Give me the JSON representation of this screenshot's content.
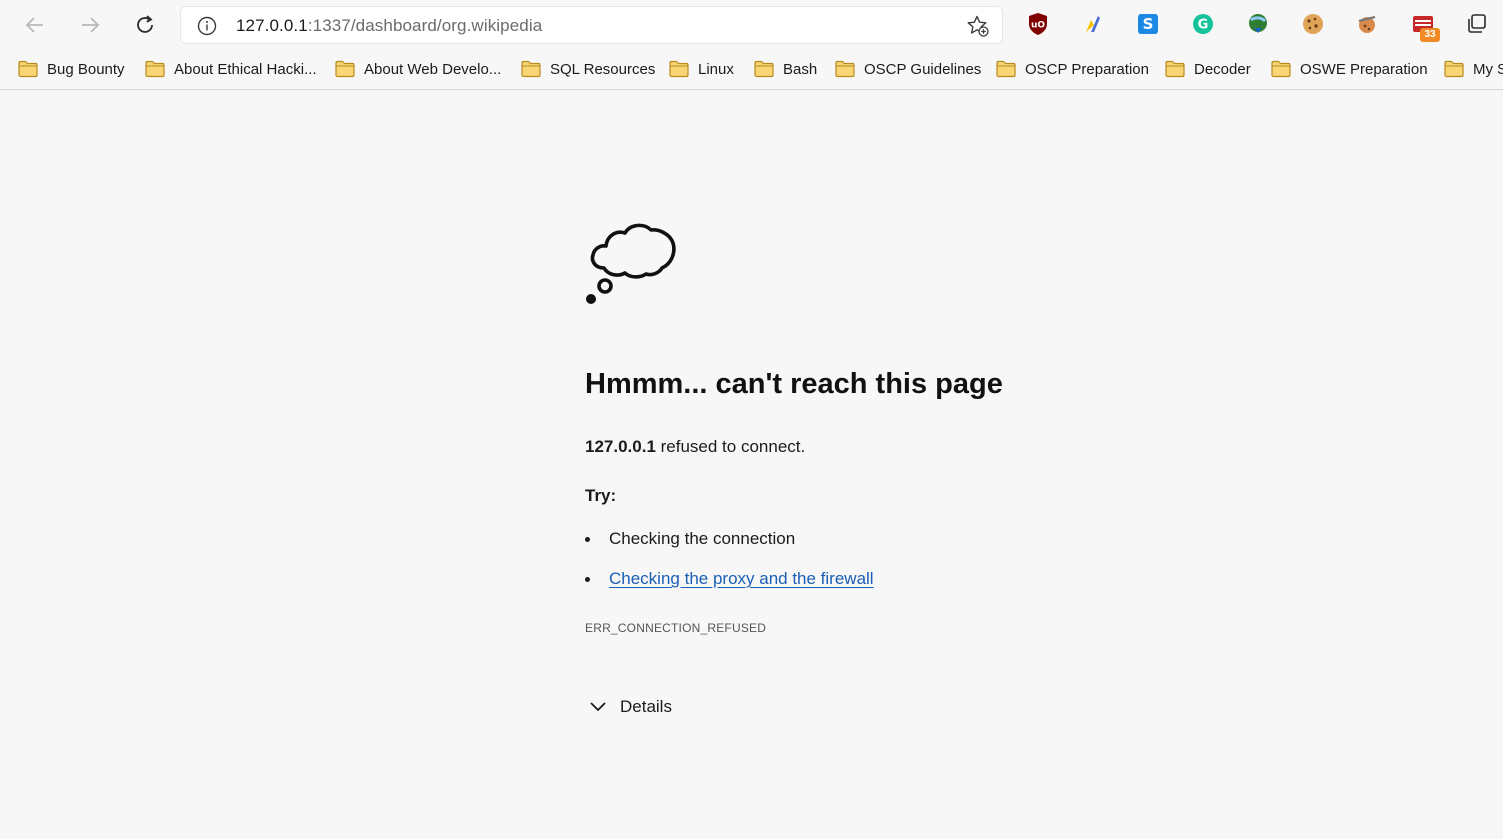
{
  "browser": {
    "address_bar": {
      "url_host": "127.0.0.1",
      "url_rest": ":1337/dashboard/org.wikipedia"
    },
    "extensions": [
      {
        "name": "ublock-origin-icon"
      },
      {
        "name": "wappalyzer-icon"
      },
      {
        "name": "s-extension-icon"
      },
      {
        "name": "grammarly-icon"
      },
      {
        "name": "idm-integration-icon"
      },
      {
        "name": "cookie-editor-icon"
      },
      {
        "name": "cookie-extension-icon"
      },
      {
        "name": "tabs-extension-icon",
        "badge": "33"
      }
    ],
    "bookmarks": [
      {
        "label": "Bug Bounty"
      },
      {
        "label": "About Ethical Hacki..."
      },
      {
        "label": "About Web Develo..."
      },
      {
        "label": "SQL Resources"
      },
      {
        "label": "Linux"
      },
      {
        "label": "Bash"
      },
      {
        "label": "OSCP Guidelines"
      },
      {
        "label": "OSCP Preparation"
      },
      {
        "label": "Decoder"
      },
      {
        "label": "OSWE Preparation"
      },
      {
        "label": "My S"
      }
    ]
  },
  "error_page": {
    "title": "Hmmm... can't reach this page",
    "host": "127.0.0.1",
    "message": " refused to connect.",
    "try_label": "Try:",
    "suggestions": [
      {
        "text": "Checking the connection"
      },
      {
        "text": "Checking the proxy and the firewall"
      }
    ],
    "error_code": "ERR_CONNECTION_REFUSED",
    "details_label": "Details"
  },
  "colors": {
    "background": "#f7f7f7",
    "link": "#1a5fb4",
    "text": "#1b1b1b"
  }
}
